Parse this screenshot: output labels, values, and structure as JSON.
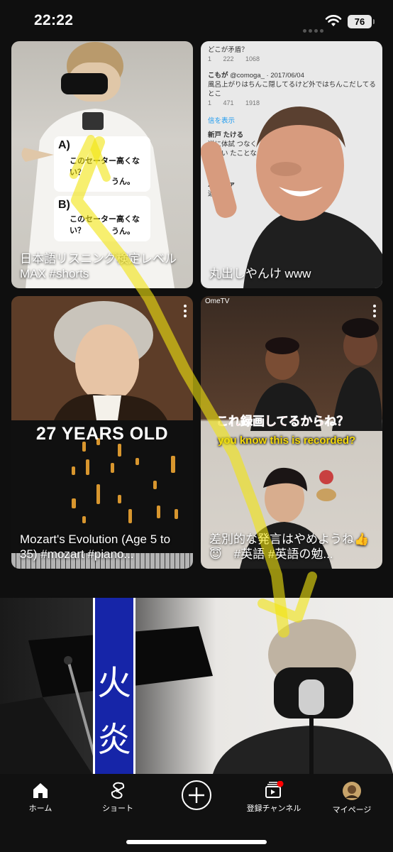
{
  "status": {
    "time": "22:22",
    "battery": "76"
  },
  "cards": [
    {
      "title": "日本語リスニング検定レベルMAX #shorts",
      "quiz": [
        {
          "letter": "A)",
          "question": "このセーター高くない？",
          "answer": "うん。"
        },
        {
          "letter": "B)",
          "question": "このセーター高くない？",
          "answer": "うん。"
        }
      ]
    },
    {
      "title": "丸出しやんけ www",
      "tweets": [
        {
          "text": "どこが矛盾？",
          "metrics": "1 222 1068"
        },
        {
          "user": "こもが",
          "handle": "@comoga_ · 2017/06/04",
          "text": "風呂上がりはちんこ隠してるけど外ではちんこだしてるとこ",
          "metrics": "1 471 1918"
        },
        {
          "text": "信を表示"
        },
        {
          "user": "新戸 たける",
          "text": "逆に体試 つなくて聞い たことな"
        },
        {
          "user": "バンダァ",
          "text": "返信先"
        }
      ]
    },
    {
      "title": "Mozart's Evolution (Age 5 to 35) #mozart #piano...",
      "overlay_text": "27 YEARS OLD"
    },
    {
      "title": "差別的な発言はやめようね👍😇　#英語 #英語の勉...",
      "badge": "OmeTV",
      "caption_jp": "これ録画してるからね？",
      "caption_en": "you know this is recorded?"
    }
  ],
  "featured": {
    "banner_chars": [
      "火",
      "炎"
    ]
  },
  "tabs": [
    {
      "label": "ホーム",
      "icon": "home-icon"
    },
    {
      "label": "ショート",
      "icon": "shorts-icon"
    },
    {
      "label": "",
      "icon": "create-plus-icon"
    },
    {
      "label": "登録チャンネル",
      "icon": "subscriptions-icon"
    },
    {
      "label": "マイページ",
      "icon": "avatar"
    }
  ],
  "colors": {
    "background": "#0f0f0f",
    "notification_dot": "#ff0000",
    "annotation_yellow": "#f2e40f"
  }
}
